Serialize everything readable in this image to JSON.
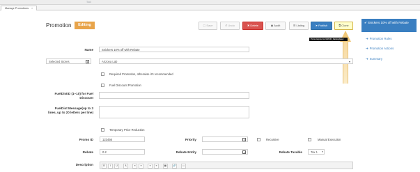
{
  "top_strip": {
    "tool_text": "Tool"
  },
  "tab": {
    "label": "Manage Promotions",
    "close": "×"
  },
  "header": {
    "title": "Promotion",
    "badge": "Editing",
    "buttons": {
      "save": "Save",
      "undo": "Undo",
      "delete": "Delete",
      "audit": "Audit",
      "listing": "Listing",
      "publish": "Publish",
      "clone": "Clone"
    }
  },
  "tooltip": "Promo Expired on MM-DD_DataUpdated",
  "side_panel": {
    "header": "Snickers 10% off with Rebate",
    "links": [
      "Promotion Rules",
      "Promotion Actions",
      "Summary"
    ]
  },
  "form": {
    "name_label": "Name",
    "name_value": "Snickers 10% off with Rebate",
    "stores_select": "Selected Stores",
    "store_value": "Arizona Lab",
    "required_promotion": "Required Promotion, otherwise it's recommended",
    "fuel_discount": "Fuel Discount Promotion",
    "fuel_id_label": "FuelDistID (1~10) for Fuel Discount",
    "fuel_msg_label": "FuelDist Message(up to 3 lines, up to 20 letters per line)",
    "temp_price_reduction": "Temporary Price Reduction",
    "promo_id_label": "Promo ID",
    "promo_id_value": "123456",
    "priority_label": "Priority",
    "recursive_label": "Recursive",
    "manual_exec_label": "Manual Execution",
    "rebate_label": "Rebate",
    "rebate_value": "0.2",
    "rebate_entity_label": "Rebate Entity",
    "rebate_taxable_label": "Rebate Taxable",
    "rebate_taxable_value": "Tax 1",
    "description_label": "Description"
  },
  "editor_toolbar": [
    "B",
    "I",
    "U",
    "A",
    "≡",
    "≡",
    "≡",
    "≡",
    "▦",
    "🔗",
    "▭"
  ],
  "colors": {
    "editing_badge": "#e8a44a",
    "delete": "#d9534f",
    "publish": "#3a7fc1",
    "clone_highlight": "#ffffcc",
    "panel": "#3a7fc1",
    "annotation_arrow": "#f0c777"
  }
}
